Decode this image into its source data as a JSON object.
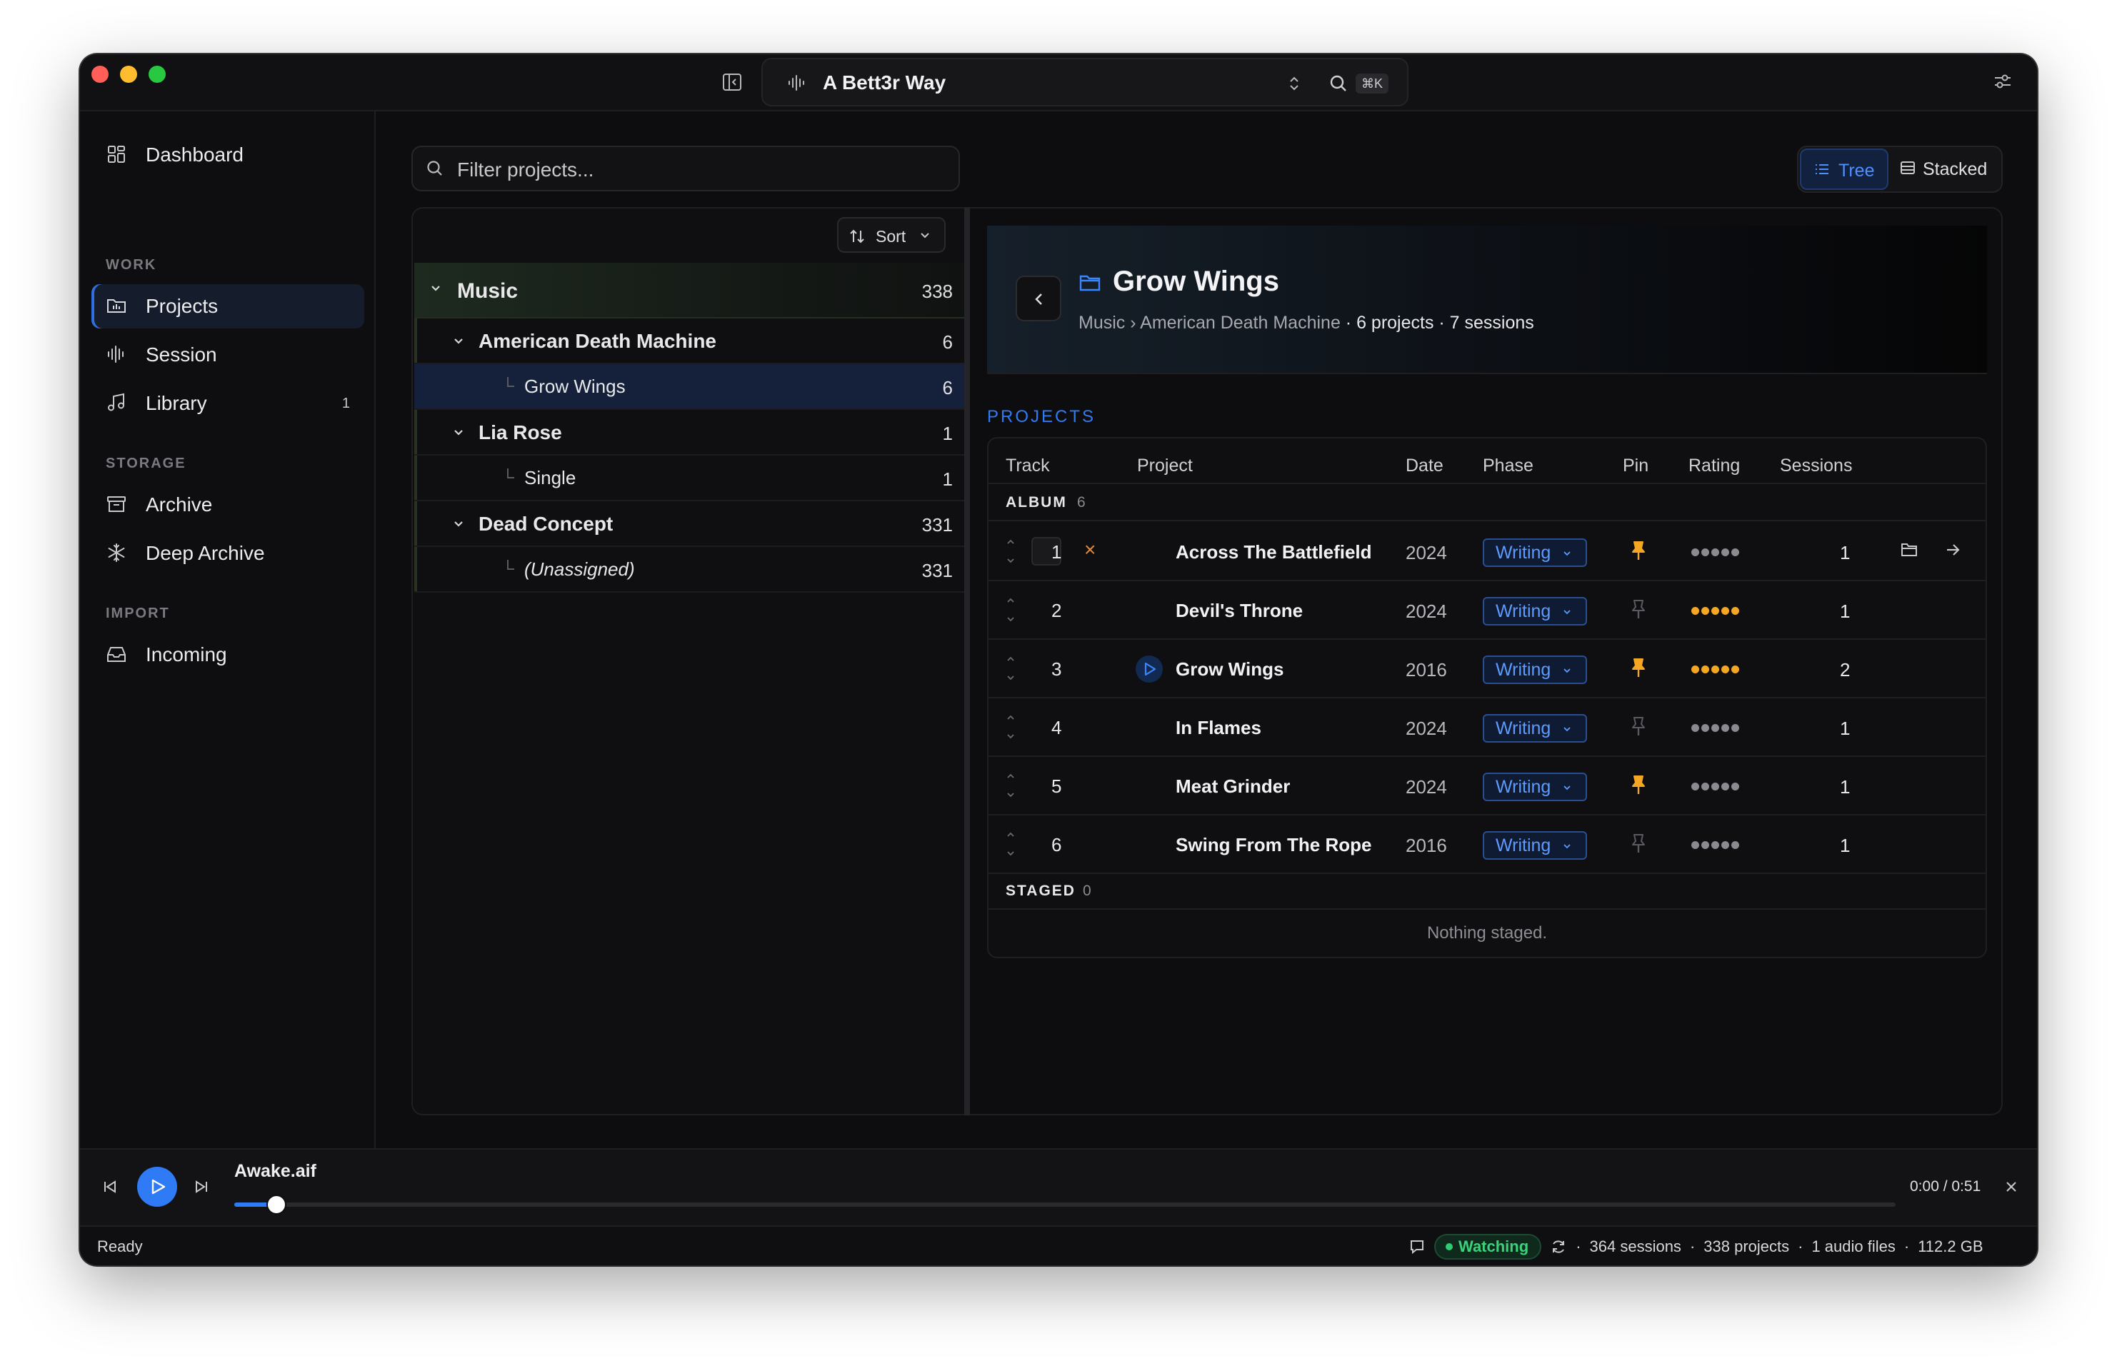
{
  "colors": {
    "accent": "#2f7bf6",
    "close": "#ff5f57",
    "minimize": "#febc2e",
    "zoom": "#28c840",
    "pin": "#f5a623",
    "watching": "#2ecc71"
  },
  "titlebar": {
    "project_name": "A Bett3r Way",
    "shortcut": "⌘K"
  },
  "sidebar": {
    "dashboard": "Dashboard",
    "sections": {
      "work": "WORK",
      "storage": "STORAGE",
      "import": "IMPORT"
    },
    "items": {
      "projects": "Projects",
      "session": "Session",
      "library": "Library",
      "library_badge": "1",
      "archive": "Archive",
      "deep_archive": "Deep Archive",
      "incoming": "Incoming"
    }
  },
  "filter": {
    "placeholder": "Filter projects..."
  },
  "view_toggle": {
    "tree": "Tree",
    "stacked": "Stacked"
  },
  "tree": {
    "sort_label": "Sort",
    "root": {
      "label": "Music",
      "count": "338"
    },
    "nodes": [
      {
        "label": "American Death Machine",
        "count": "6"
      },
      {
        "label": "Grow Wings",
        "count": "6"
      },
      {
        "label": "Lia Rose",
        "count": "1"
      },
      {
        "label": "Single",
        "count": "1"
      },
      {
        "label": "Dead Concept",
        "count": "331"
      },
      {
        "label": "(Unassigned)",
        "count": "331"
      }
    ]
  },
  "detail": {
    "title": "Grow Wings",
    "crumb_root": "Music",
    "crumb_sep": "›",
    "crumb_parent": "American Death Machine",
    "crumb_stats": " · 6 projects · 7 sessions",
    "section_label": "PROJECTS",
    "columns": {
      "track": "Track",
      "project": "Project",
      "date": "Date",
      "phase": "Phase",
      "pin": "Pin",
      "rating": "Rating",
      "sessions": "Sessions"
    },
    "album_label": "ALBUM",
    "album_count": "6",
    "rows": [
      {
        "track": "1",
        "name": "Across The Battlefield",
        "date": "2024",
        "phase": "Writing",
        "pinned": true,
        "rating": 0,
        "sessions": "1",
        "remove": "×"
      },
      {
        "track": "2",
        "name": "Devil's Throne",
        "date": "2024",
        "phase": "Writing",
        "pinned": false,
        "rating": 5,
        "sessions": "1"
      },
      {
        "track": "3",
        "name": "Grow Wings",
        "date": "2016",
        "phase": "Writing",
        "pinned": true,
        "rating": 5,
        "sessions": "2"
      },
      {
        "track": "4",
        "name": "In Flames",
        "date": "2024",
        "phase": "Writing",
        "pinned": false,
        "rating": 0,
        "sessions": "1"
      },
      {
        "track": "5",
        "name": "Meat Grinder",
        "date": "2024",
        "phase": "Writing",
        "pinned": true,
        "rating": 0,
        "sessions": "1"
      },
      {
        "track": "6",
        "name": "Swing From The Rope",
        "date": "2016",
        "phase": "Writing",
        "pinned": false,
        "rating": 0,
        "sessions": "1"
      }
    ],
    "staged_label": "STAGED",
    "staged_count": "0",
    "staged_empty": "Nothing staged."
  },
  "player": {
    "filename": "Awake.aif",
    "time": "0:00 / 0:51",
    "progress": 0.02
  },
  "status": {
    "ready": "Ready",
    "watching": "Watching",
    "sessions": "364 sessions",
    "projects": "338 projects",
    "audio": "1 audio files",
    "size": "112.2 GB",
    "sep": "·"
  }
}
